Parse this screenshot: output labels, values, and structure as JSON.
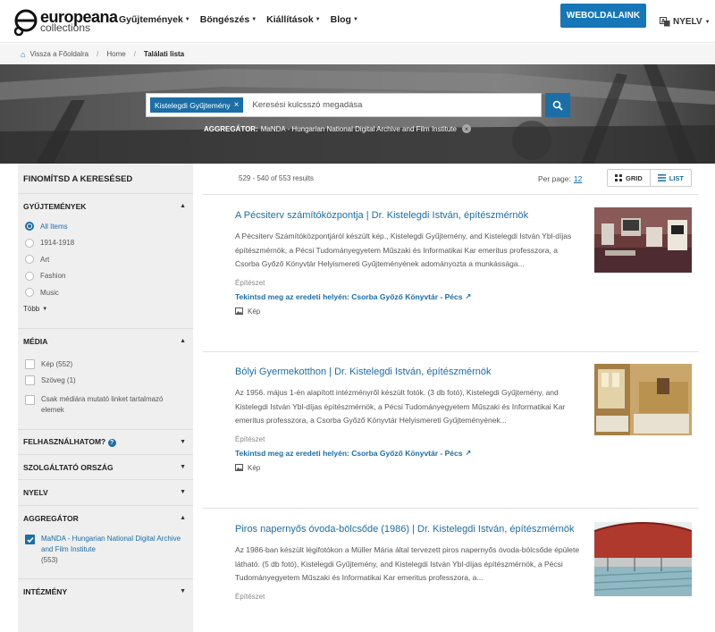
{
  "header": {
    "logo_line1": "europeana",
    "logo_line2": "collections",
    "nav": [
      "Gyűjtemények",
      "Böngészés",
      "Kiállítások",
      "Blog"
    ],
    "site_button": "WEBOLDALAINK",
    "language": "NYELV"
  },
  "breadcrumb": {
    "back": "Vissza a Főoldalra",
    "home": "Home",
    "current": "Találati lista"
  },
  "search": {
    "filter_pill": "Kistelegdi Gyűjtemény",
    "placeholder": "Keresési kulcsszó megadása",
    "aggregator_label": "AGGREGÁTOR:",
    "aggregator_value": "MaNDA - Hungarian National Digital Archive and Film Institute"
  },
  "sidebar": {
    "title": "FINOMÍTSD A KERESÉSED",
    "collections": {
      "label": "GYŰJTEMÉNYEK",
      "options": [
        "All Items",
        "1914-1918",
        "Art",
        "Fashion",
        "Music"
      ],
      "more": "Több"
    },
    "media": {
      "label": "MÉDIA",
      "options": [
        "Kép (552)",
        "Szöveg (1)",
        "Csak médiára mutató linket tartalmazó elemek"
      ]
    },
    "usability": "FELHASZNÁLHATOM?",
    "provider_country": "SZOLGÁLTATÓ ORSZÁG",
    "language": "NYELV",
    "aggregator": {
      "label": "AGGREGÁTOR",
      "option_name": "MaNDA - Hungarian National Digital Archive and Film Institute",
      "option_count": "(553)"
    },
    "institution": "INTÉZMÉNY"
  },
  "results": {
    "count": "529 - 540 of 553 results",
    "per_page_label": "Per page:",
    "per_page_value": "12",
    "grid_label": "GRID",
    "list_label": "LIST",
    "items": [
      {
        "title": "A Pécsiterv számítóközpontja | Dr. Kistelegdi István, építészmérnök",
        "desc": "A Pécsiterv Számítóközpontjáról készült kép., Kistelegdi Gyűjtemény, and Kistelegdi István Ybl-díjas építészmérnök, a Pécsi Tudományegyetem Műszaki és Informatikai Kar emeritus professzora, a Csorba Győző Könyvtár Helyismereti Gyűjteményének adományozta a munkássága...",
        "type": "Építészet",
        "link": "Tekintsd meg az eredeti helyén: Csorba Győző Könyvtár - Pécs",
        "media": "Kép"
      },
      {
        "title": "Bólyi Gyermekotthon | Dr. Kistelegdi István, építészmérnök",
        "desc": "Az 1956. május 1-én alapított intézményről készült fotók. (3 db fotó), Kistelegdi Gyűjtemény, and Kistelegdi István Ybl-díjas építészmérnök, a Pécsi Tudományegyetem Műszaki és Informatikai Kar emeritus professzora, a Csorba Győző Könyvtár Helyismereti Gyűjteményének...",
        "type": "Építészet",
        "link": "Tekintsd meg az eredeti helyén: Csorba Győző Könyvtár - Pécs",
        "media": "Kép"
      },
      {
        "title": "Piros napernyős óvoda-bölcsőde (1986) | Dr. Kistelegdi István, építészmérnök",
        "desc": "Az 1986-ban készült légifotókon a Müller Mária által tervezett piros napernyős óvoda-bölcsőde épülete látható. (5 db fotó), Kistelegdi Gyűjtemény, and Kistelegdi István Ybl-díjas építészmérnök, a Pécsi Tudományegyetem Műszaki és Informatikai Kar emeritus professzora, a...",
        "type": "Építészet"
      }
    ]
  },
  "colors": {
    "accent": "#1b6ea6",
    "button": "#1676b6",
    "sidebar_bg": "#efefef"
  }
}
